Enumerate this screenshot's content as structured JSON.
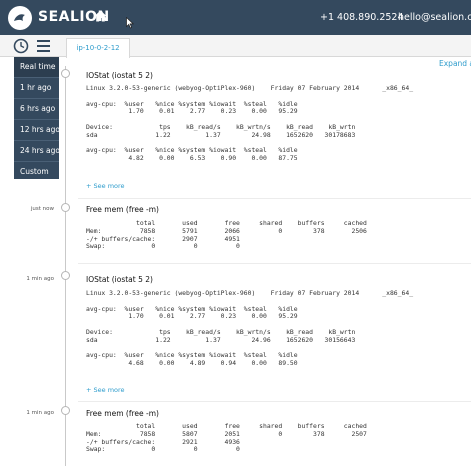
{
  "header": {
    "logo_text": "SEALION",
    "phone": "+1 408.890.2524",
    "email": "hello@sealion.com",
    "brand_color": "#34495e",
    "accent_color": "#2e9ccc"
  },
  "subnav": {
    "host_tab": "ip-10-0-2-12",
    "expand_label": "Expand all"
  },
  "time_menu": {
    "items": [
      "Real time",
      "1 hr ago",
      "6 hrs ago",
      "12 hrs ago",
      "24 hrs ago",
      "Custom"
    ],
    "selected": "Real time"
  },
  "entries": [
    {
      "time": "",
      "title": "IOStat (iostat 5 2)",
      "lines": [
        "Linux 3.2.0-53-generic (webyog-OptiPlex-960)    Friday 07 February 2014      _x86_64_",
        "",
        "avg-cpu:  %user   %nice %system %iowait  %steal   %idle",
        "           1.70    0.01    2.77    0.23    0.00   95.29",
        "",
        "Device:            tps    kB_read/s    kB_wrtn/s    kB_read    kB_wrtn",
        "sda               1.22         1.37        24.98    1652620   30178683",
        "",
        "avg-cpu:  %user   %nice %system %iowait  %steal   %idle",
        "           4.82    0.00    6.53    0.90    0.00   87.75"
      ],
      "see_more": "+ See more"
    },
    {
      "time": "just now",
      "title": "Free mem (free -m)",
      "lines": [
        "             total       used       free     shared    buffers     cached",
        "Mem:          7858       5791       2066          0        378       2506",
        "-/+ buffers/cache:       2907       4951",
        "Swap:            0          0          0"
      ],
      "see_more": ""
    },
    {
      "time": "1 min ago",
      "title": "IOStat (iostat 5 2)",
      "lines": [
        "Linux 3.2.0-53-generic (webyog-OptiPlex-960)    Friday 07 February 2014      _x86_64_",
        "",
        "avg-cpu:  %user   %nice %system %iowait  %steal   %idle",
        "           1.70    0.01    2.77    0.23    0.00   95.29",
        "",
        "Device:            tps    kB_read/s    kB_wrtn/s    kB_read    kB_wrtn",
        "sda               1.22         1.37        24.96    1652620   30156643",
        "",
        "avg-cpu:  %user   %nice %system %iowait  %steal   %idle",
        "           4.68    0.00    4.89    0.94    0.00   89.50"
      ],
      "see_more": "+ See more"
    },
    {
      "time": "1 min ago",
      "title": "Free mem (free -m)",
      "lines": [
        "             total       used       free     shared    buffers     cached",
        "Mem:          7858       5807       2051          0        378       2507",
        "-/+ buffers/cache:       2921       4936",
        "Swap:            0          0          0"
      ],
      "see_more": ""
    }
  ]
}
